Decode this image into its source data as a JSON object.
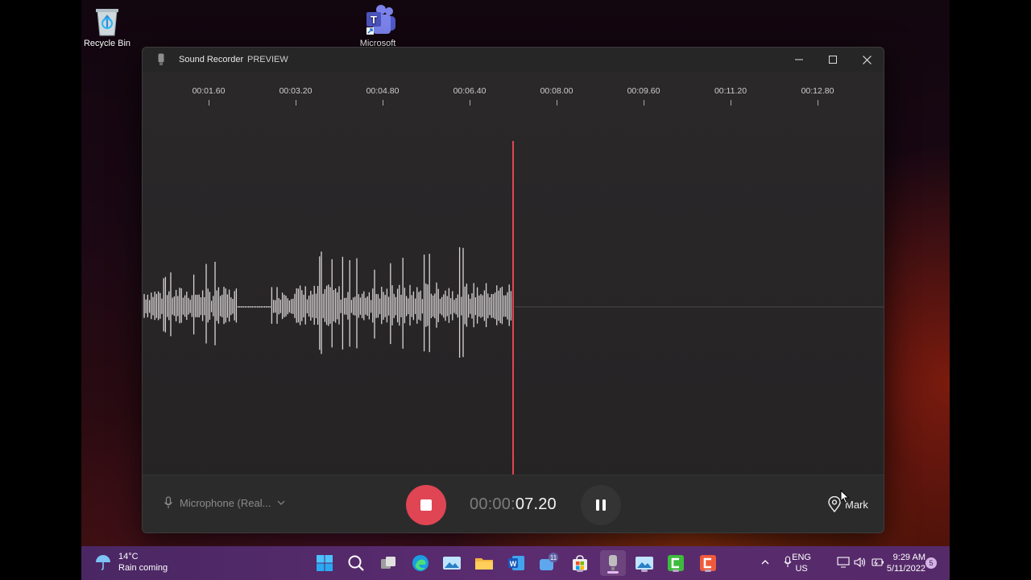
{
  "desktop": {
    "icons": [
      {
        "label": "Recycle Bin",
        "icon": "recycle-bin-icon"
      },
      {
        "label": "Microsoft",
        "icon": "teams-icon"
      }
    ]
  },
  "window": {
    "title": "Sound Recorder",
    "badge": "PREVIEW",
    "buttons": {
      "minimize": "minimize-icon",
      "maximize": "maximize-icon",
      "close": "close-icon"
    }
  },
  "timeline": {
    "ticks": [
      "00:01.60",
      "00:03.20",
      "00:04.80",
      "00:06.40",
      "00:08.00",
      "00:09.60",
      "00:11.20",
      "00:12.80"
    ],
    "playhead_color": "#e04554",
    "waveform_color": "#d9d5d6"
  },
  "controls": {
    "microphone_label": "Microphone (Real...",
    "timer_dim": "00:00:",
    "timer_bright": "07.20",
    "mark_label": "Mark",
    "record_color": "#e04554"
  },
  "taskbar": {
    "weather_temp": "14°C",
    "weather_desc": "Rain coming",
    "apps": [
      "start-icon",
      "search-icon",
      "task-view-icon",
      "edge-icon",
      "photos-icon",
      "file-explorer-icon",
      "word-icon",
      "teams-chat-icon",
      "store-icon",
      "sound-recorder-icon",
      "photos-2-icon",
      "camtasia-icon",
      "camtasia-2-icon"
    ],
    "teams_badge": "11",
    "lang_top": "ENG",
    "lang_bottom": "US",
    "time": "9:29 AM",
    "date": "5/11/2022",
    "notification_count": "5"
  }
}
